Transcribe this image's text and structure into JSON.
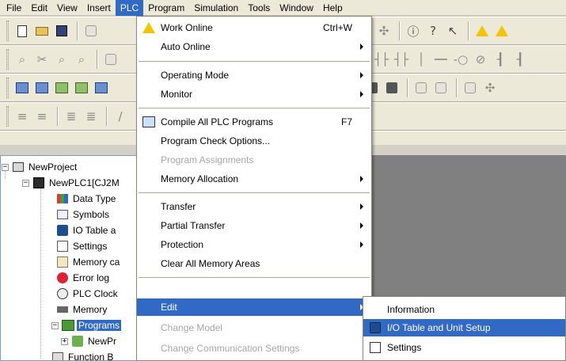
{
  "menubar": {
    "items": [
      "File",
      "Edit",
      "View",
      "Insert",
      "PLC",
      "Program",
      "Simulation",
      "Tools",
      "Window",
      "Help"
    ],
    "active": "PLC"
  },
  "plc_menu": {
    "work_online": {
      "label": "Work Online",
      "shortcut": "Ctrl+W"
    },
    "auto_online": "Auto Online",
    "operating_mode": "Operating Mode",
    "monitor": "Monitor",
    "compile_all": {
      "label": "Compile All PLC Programs",
      "shortcut": "F7"
    },
    "program_check_options": "Program Check Options...",
    "program_assignments": "Program Assignments",
    "memory_allocation": "Memory Allocation",
    "transfer": "Transfer",
    "partial_transfer": "Partial Transfer",
    "protection": "Protection",
    "clear_all_memory": "Clear All Memory Areas",
    "edit": "Edit",
    "change_model": "Change Model",
    "change_comm_settings": "Change Communication Settings"
  },
  "edit_submenu": {
    "information": "Information",
    "io_table": "I/O Table and Unit Setup",
    "settings": "Settings"
  },
  "tree": {
    "project": "NewProject",
    "plc": "NewPLC1[CJ2M",
    "data_type": "Data Type",
    "symbols": "Symbols",
    "io_table": "IO Table a",
    "settings": "Settings",
    "memory_card": "Memory ca",
    "error_log": "Error log",
    "plc_clock": "PLC Clock",
    "memory": "Memory",
    "programs": "Programs",
    "new_program": "NewPr",
    "function_blocks": "Function B"
  },
  "colors": {
    "highlight": "#316ac5",
    "chrome": "#ece9d8",
    "workspace": "#808080"
  }
}
